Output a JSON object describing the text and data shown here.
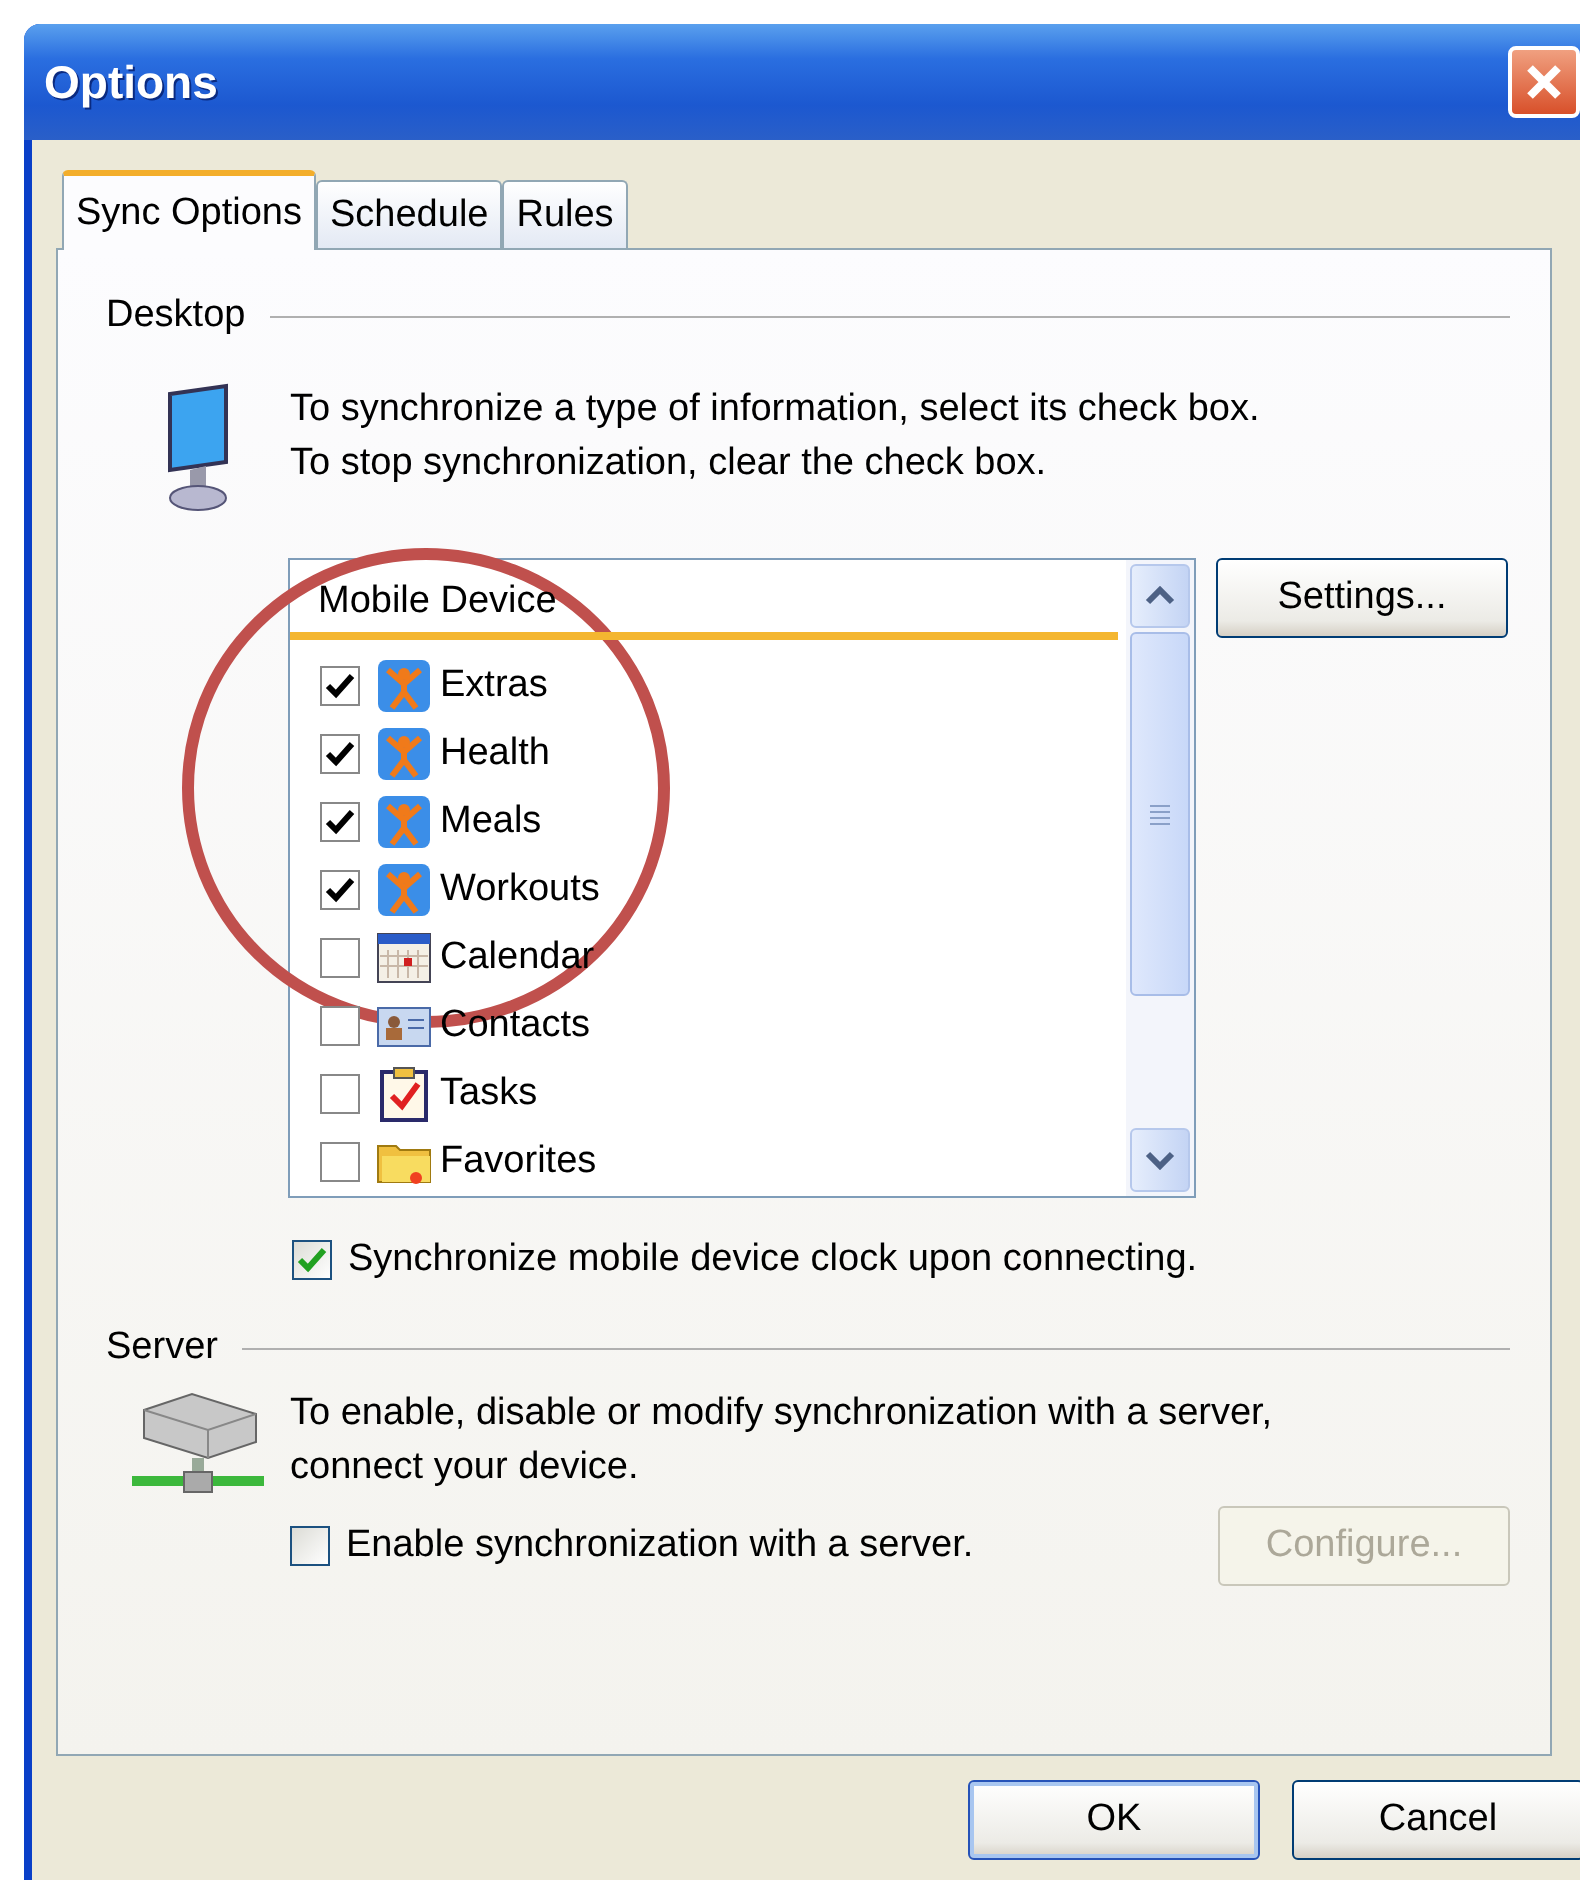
{
  "window": {
    "title": "Options"
  },
  "tabs": [
    {
      "label": "Sync Options",
      "selected": true
    },
    {
      "label": "Schedule",
      "selected": false
    },
    {
      "label": "Rules",
      "selected": false
    }
  ],
  "desktop": {
    "heading": "Desktop",
    "description": [
      "To synchronize a type of information, select its check box.",
      "To stop synchronization, clear the check box."
    ],
    "list": {
      "header": "Mobile Device",
      "items": [
        {
          "label": "Extras",
          "checked": true,
          "kind": "app"
        },
        {
          "label": "Health",
          "checked": true,
          "kind": "app"
        },
        {
          "label": "Meals",
          "checked": true,
          "kind": "app"
        },
        {
          "label": "Workouts",
          "checked": true,
          "kind": "app"
        },
        {
          "label": "Calendar",
          "checked": false,
          "kind": "calendar"
        },
        {
          "label": "Contacts",
          "checked": false,
          "kind": "contacts"
        },
        {
          "label": "Tasks",
          "checked": false,
          "kind": "tasks"
        },
        {
          "label": "Favorites",
          "checked": false,
          "kind": "folder"
        }
      ]
    },
    "settings_button": "Settings...",
    "clock_option": {
      "label": "Synchronize mobile device clock upon connecting.",
      "checked": true
    }
  },
  "server": {
    "heading": "Server",
    "description": [
      "To enable, disable or modify synchronization with a server,",
      "connect your device."
    ],
    "enable_option": {
      "label": "Enable synchronization with a server.",
      "checked": false
    },
    "configure_button": {
      "label": "Configure...",
      "disabled": true
    }
  },
  "buttons": [
    {
      "label": "OK",
      "default": true
    },
    {
      "label": "Cancel",
      "default": false
    }
  ]
}
